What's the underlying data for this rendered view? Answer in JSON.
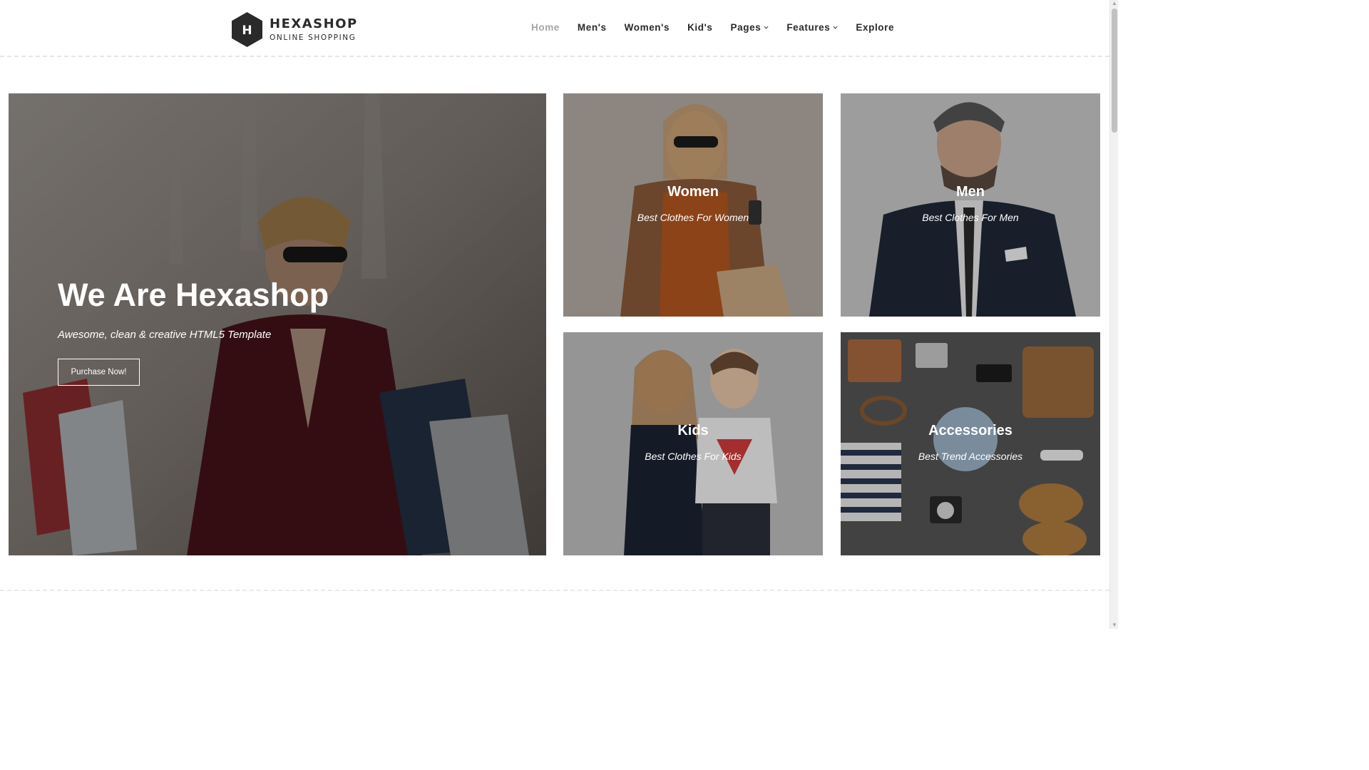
{
  "brand": {
    "name": "HEXASHOP",
    "tagline": "ONLINE SHOPPING",
    "logo_letter": "H",
    "logo_color": "#2a2a2a"
  },
  "nav": {
    "items": [
      {
        "label": "Home",
        "active": true
      },
      {
        "label": "Men's"
      },
      {
        "label": "Women's"
      },
      {
        "label": "Kid's"
      },
      {
        "label": "Pages",
        "dropdown": true
      },
      {
        "label": "Features",
        "dropdown": true
      },
      {
        "label": "Explore"
      }
    ]
  },
  "hero": {
    "title": "We Are Hexashop",
    "subtitle": "Awesome, clean & creative HTML5 Template",
    "button": "Purchase Now!"
  },
  "categories": [
    {
      "title": "Women",
      "subtitle": "Best Clothes For Women"
    },
    {
      "title": "Men",
      "subtitle": "Best Clothes For Men"
    },
    {
      "title": "Kids",
      "subtitle": "Best Clothes For Kids"
    },
    {
      "title": "Accessories",
      "subtitle": "Best Trend Accessories"
    }
  ],
  "colors": {
    "text": "#2a2a2a",
    "active_nav": "#a6a6a6",
    "overlay": "rgba(0,0,0,0.42)"
  }
}
